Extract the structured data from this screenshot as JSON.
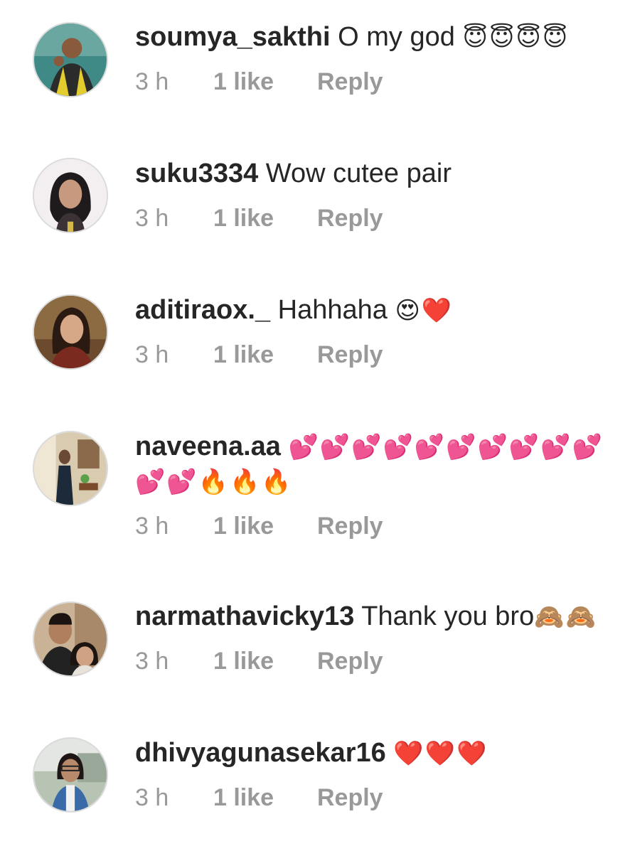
{
  "comments": [
    {
      "username": "soumya_sakthi",
      "text": "O my god",
      "emojis": "😇😇😇😇",
      "emojis_line2": "",
      "avatar": "avatar-man-yellow-jacket",
      "time": "3 h",
      "likes": "1 like",
      "reply": "Reply"
    },
    {
      "username": "suku3334",
      "text": "Wow cutee pair",
      "emojis": "",
      "emojis_line2": "",
      "avatar": "avatar-woman-headphones",
      "time": "3 h",
      "likes": "1 like",
      "reply": "Reply"
    },
    {
      "username": "aditiraox._",
      "text": "Hahhaha",
      "emojis": "😍❤️",
      "emojis_line2": "",
      "avatar": "avatar-woman-portrait",
      "time": "3 h",
      "likes": "1 like",
      "reply": "Reply"
    },
    {
      "username": "naveena.aa",
      "text": "",
      "emojis": "💕💕💕💕💕💕💕💕💕💕",
      "emojis_line2": "💕💕🔥🔥🔥",
      "avatar": "avatar-woman-room",
      "time": "3 h",
      "likes": "1 like",
      "reply": "Reply"
    },
    {
      "username": "narmathavicky13",
      "text": "Thank you bro",
      "emojis": "🙈🙈",
      "emojis_line2": "",
      "avatar": "avatar-couple-selfie",
      "time": "3 h",
      "likes": "1 like",
      "reply": "Reply"
    },
    {
      "username": "dhivyagunasekar16",
      "text": "",
      "emojis": "❤️❤️❤️",
      "emojis_line2": "",
      "avatar": "avatar-woman-glasses",
      "time": "3 h",
      "likes": "1 like",
      "reply": "Reply"
    }
  ]
}
